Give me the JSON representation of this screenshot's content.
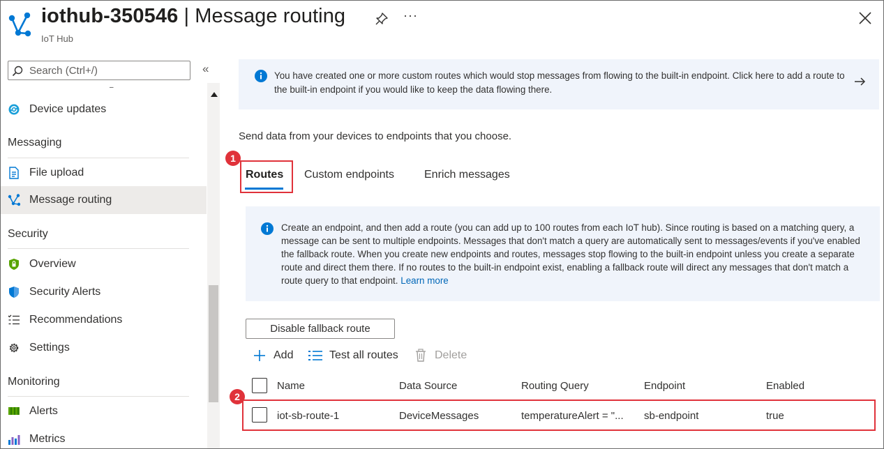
{
  "header": {
    "resource_name": "iothub-350546",
    "separator": " | ",
    "page_name": "Message routing",
    "subtitle": "IoT Hub",
    "more_label": "···"
  },
  "sidebar": {
    "search_placeholder": "Search (Ctrl+/)",
    "collapse_label": "«",
    "top_items": [
      {
        "label": "Device updates",
        "icon": "device-updates-icon"
      }
    ],
    "sections": [
      {
        "title": "Messaging",
        "items": [
          {
            "label": "File upload",
            "icon": "file-upload-icon",
            "active": false
          },
          {
            "label": "Message routing",
            "icon": "message-routing-icon",
            "active": true
          }
        ]
      },
      {
        "title": "Security",
        "items": [
          {
            "label": "Overview",
            "icon": "shield-icon",
            "active": false
          },
          {
            "label": "Security Alerts",
            "icon": "security-alert-icon",
            "active": false
          },
          {
            "label": "Recommendations",
            "icon": "recommendations-icon",
            "active": false
          },
          {
            "label": "Settings",
            "icon": "gear-icon",
            "active": false
          }
        ]
      },
      {
        "title": "Monitoring",
        "items": [
          {
            "label": "Alerts",
            "icon": "alerts-icon",
            "active": false
          },
          {
            "label": "Metrics",
            "icon": "metrics-icon",
            "active": false
          }
        ]
      }
    ]
  },
  "main": {
    "top_banner": "You have created one or more custom routes which would stop messages from flowing to the built-in endpoint.  Click here to add a route to the built-in endpoint if you would like to keep the data flowing there.",
    "intro": "Send data from your devices to endpoints that you choose.",
    "tabs": [
      {
        "label": "Routes",
        "active": true
      },
      {
        "label": "Custom endpoints",
        "active": false
      },
      {
        "label": "Enrich messages",
        "active": false
      }
    ],
    "info_text": "Create an endpoint, and then add a route (you can add up to 100 routes from each IoT hub). Since routing is based on a matching query, a message can be sent to multiple endpoints. Messages that don't match a query are automatically sent to messages/events if you've enabled the fallback route. When you create new endpoints and routes, messages stop flowing to the built-in endpoint unless you create a separate route and direct them there. If no routes to the built-in endpoint exist, enabling a fallback route will direct any messages that don't match a route query to that endpoint.",
    "learn_more": "Learn more",
    "fallback_button": "Disable fallback route",
    "toolbar": {
      "add": "Add",
      "test_all": "Test all routes",
      "delete": "Delete"
    },
    "table": {
      "columns": [
        "Name",
        "Data Source",
        "Routing Query",
        "Endpoint",
        "Enabled"
      ],
      "rows": [
        [
          "iot-sb-route-1",
          "DeviceMessages",
          "temperatureAlert = \"...",
          "sb-endpoint",
          "true"
        ]
      ]
    },
    "callouts": [
      "1",
      "2"
    ]
  },
  "colors": {
    "accent": "#0078d4",
    "callout": "#e0323a",
    "info_bg": "#f0f4fb",
    "link": "#0067b8"
  }
}
